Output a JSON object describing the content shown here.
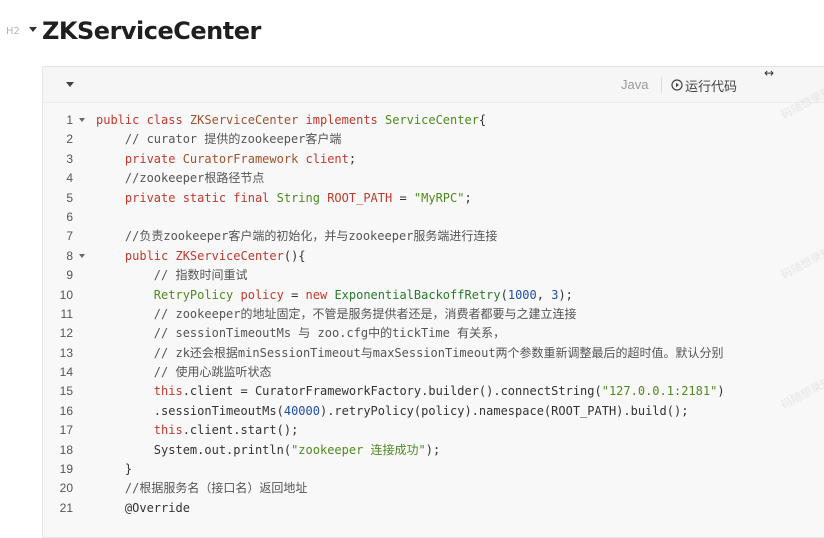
{
  "heading": {
    "marker": "H2",
    "title": "ZKServiceCenter"
  },
  "toolbar": {
    "language": "Java",
    "run_label": "运行代码",
    "collapse_symbol": "↔"
  },
  "watermark": {
    "text": "码随想录知识"
  },
  "code": [
    {
      "n": "1",
      "fold": true,
      "tokens": [
        [
          "kw",
          "public class "
        ],
        [
          "cls",
          "ZKServiceCenter "
        ],
        [
          "kw",
          "implements "
        ],
        [
          "typ",
          "ServiceCenter"
        ],
        [
          "",
          "{"
        ]
      ]
    },
    {
      "n": "2",
      "fold": false,
      "tokens": [
        [
          "cmt",
          "    // curator 提供的zookeeper客户端"
        ]
      ]
    },
    {
      "n": "3",
      "fold": false,
      "tokens": [
        [
          "kw",
          "    private "
        ],
        [
          "cls",
          "CuratorFramework "
        ],
        [
          "var",
          "client"
        ],
        [
          "",
          ";"
        ]
      ]
    },
    {
      "n": "4",
      "fold": false,
      "tokens": [
        [
          "cmt",
          "    //zookeeper根路径节点"
        ]
      ]
    },
    {
      "n": "5",
      "fold": false,
      "tokens": [
        [
          "kw",
          "    private static final "
        ],
        [
          "typ",
          "String "
        ],
        [
          "var",
          "ROOT_PATH "
        ],
        [
          "",
          "= "
        ],
        [
          "str",
          "\"MyRPC\""
        ],
        [
          "",
          ";"
        ]
      ]
    },
    {
      "n": "6",
      "fold": false,
      "tokens": [
        [
          "",
          ""
        ]
      ]
    },
    {
      "n": "7",
      "fold": false,
      "tokens": [
        [
          "cmt",
          "    //负责zookeeper客户端的初始化，并与zookeeper服务端进行连接"
        ]
      ]
    },
    {
      "n": "8",
      "fold": true,
      "tokens": [
        [
          "kw",
          "    public "
        ],
        [
          "var",
          "ZKServiceCenter"
        ],
        [
          "",
          "(){"
        ]
      ]
    },
    {
      "n": "9",
      "fold": false,
      "tokens": [
        [
          "cmt",
          "        // 指数时间重试"
        ]
      ]
    },
    {
      "n": "10",
      "fold": false,
      "tokens": [
        [
          "typ",
          "        RetryPolicy "
        ],
        [
          "var",
          "policy "
        ],
        [
          "",
          "= "
        ],
        [
          "kw",
          "new "
        ],
        [
          "fn",
          "ExponentialBackoffRetry"
        ],
        [
          "",
          "("
        ],
        [
          "num",
          "1000"
        ],
        [
          "",
          ", "
        ],
        [
          "num",
          "3"
        ],
        [
          "",
          ");"
        ]
      ]
    },
    {
      "n": "11",
      "fold": false,
      "tokens": [
        [
          "cmt",
          "        // zookeeper的地址固定，不管是服务提供者还是，消费者都要与之建立连接"
        ]
      ]
    },
    {
      "n": "12",
      "fold": false,
      "tokens": [
        [
          "cmt",
          "        // sessionTimeoutMs 与 zoo.cfg中的tickTime 有关系，"
        ]
      ]
    },
    {
      "n": "13",
      "fold": false,
      "tokens": [
        [
          "cmt",
          "        // zk还会根据minSessionTimeout与maxSessionTimeout两个参数重新调整最后的超时值。默认分别"
        ]
      ]
    },
    {
      "n": "14",
      "fold": false,
      "tokens": [
        [
          "cmt",
          "        // 使用心跳监听状态"
        ]
      ]
    },
    {
      "n": "15",
      "fold": false,
      "tokens": [
        [
          "kw",
          "        this"
        ],
        [
          "",
          ".client = CuratorFrameworkFactory.builder().connectString("
        ],
        [
          "str",
          "\"127.0.0.1:2181\""
        ],
        [
          "",
          ")"
        ]
      ]
    },
    {
      "n": "16",
      "fold": false,
      "tokens": [
        [
          "",
          "        .sessionTimeoutMs("
        ],
        [
          "num",
          "40000"
        ],
        [
          "",
          ").retryPolicy(policy).namespace(ROOT_PATH).build();"
        ]
      ]
    },
    {
      "n": "17",
      "fold": false,
      "tokens": [
        [
          "kw",
          "        this"
        ],
        [
          "",
          ".client.start();"
        ]
      ]
    },
    {
      "n": "18",
      "fold": false,
      "tokens": [
        [
          "",
          "        System.out.println("
        ],
        [
          "str",
          "\"zookeeper 连接成功\""
        ],
        [
          "",
          ");"
        ]
      ]
    },
    {
      "n": "19",
      "fold": false,
      "tokens": [
        [
          "",
          "    }"
        ]
      ]
    },
    {
      "n": "20",
      "fold": false,
      "tokens": [
        [
          "cmt",
          "    //根据服务名（接口名）返回地址"
        ]
      ]
    },
    {
      "n": "21",
      "fold": false,
      "tokens": [
        [
          "",
          "    @Override"
        ]
      ]
    }
  ]
}
